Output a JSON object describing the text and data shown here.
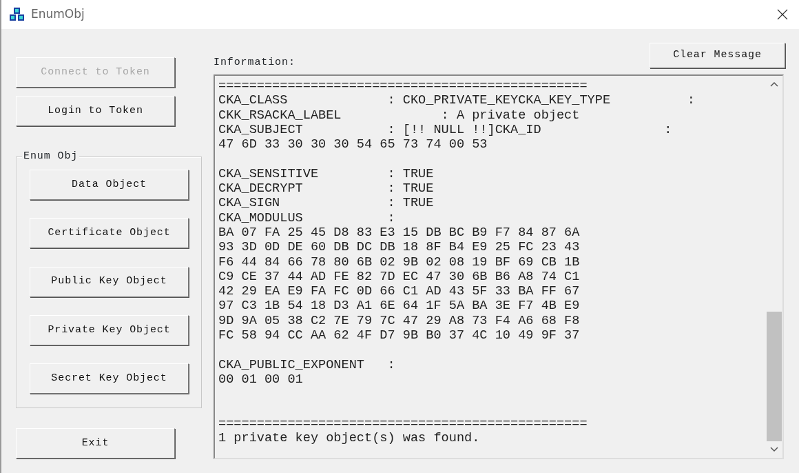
{
  "window": {
    "title": "EnumObj"
  },
  "token_buttons": [
    {
      "label": "Connect to Token",
      "disabled": true
    },
    {
      "label": "Login to Token",
      "disabled": false
    }
  ],
  "enum_group": {
    "title": "Enum Obj",
    "buttons": [
      {
        "label": "Data Object",
        "disabled": false
      },
      {
        "label": "Certificate Object",
        "disabled": false
      },
      {
        "label": "Public Key Object",
        "disabled": false
      },
      {
        "label": "Private Key Object",
        "disabled": false
      },
      {
        "label": "Secret Key Object",
        "disabled": false
      }
    ]
  },
  "exit_button": {
    "label": "Exit",
    "disabled": false
  },
  "clear_button": {
    "label": "Clear Message",
    "disabled": false
  },
  "information": {
    "label": "Information:",
    "text": "================================================\nCKA_CLASS             : CKO_PRIVATE_KEYCKA_KEY_TYPE          :\nCKK_RSACKA_LABEL             : A private object\nCKA_SUBJECT           : [!! NULL !!]CKA_ID                :\n47 6D 33 30 30 30 54 65 73 74 00 53\n\nCKA_SENSITIVE         : TRUE\nCKA_DECRYPT           : TRUE\nCKA_SIGN              : TRUE\nCKA_MODULUS           :\nBA 07 FA 25 45 D8 83 E3 15 DB BC B9 F7 84 87 6A\n93 3D 0D DE 60 DB DC DB 18 8F B4 E9 25 FC 23 43\nF6 44 84 66 78 80 6B 02 9B 02 08 19 BF 69 CB 1B\nC9 CE 37 44 AD FE 82 7D EC 47 30 6B B6 A8 74 C1\n42 29 EA E9 FA FC 0D 66 C1 AD 43 5F 33 BA FF 67\n97 C3 1B 54 18 D3 A1 6E 64 1F 5A BA 3E F7 4B E9\n9D 9A 05 38 C2 7E 79 7C 47 29 A8 73 F4 A6 68 F8\nFC 58 94 CC AA 62 4F D7 9B B0 37 4C 10 49 9F 37\n\nCKA_PUBLIC_EXPONENT   :\n00 01 00 01\n\n\n================================================\n1 private key object(s) was found."
  }
}
